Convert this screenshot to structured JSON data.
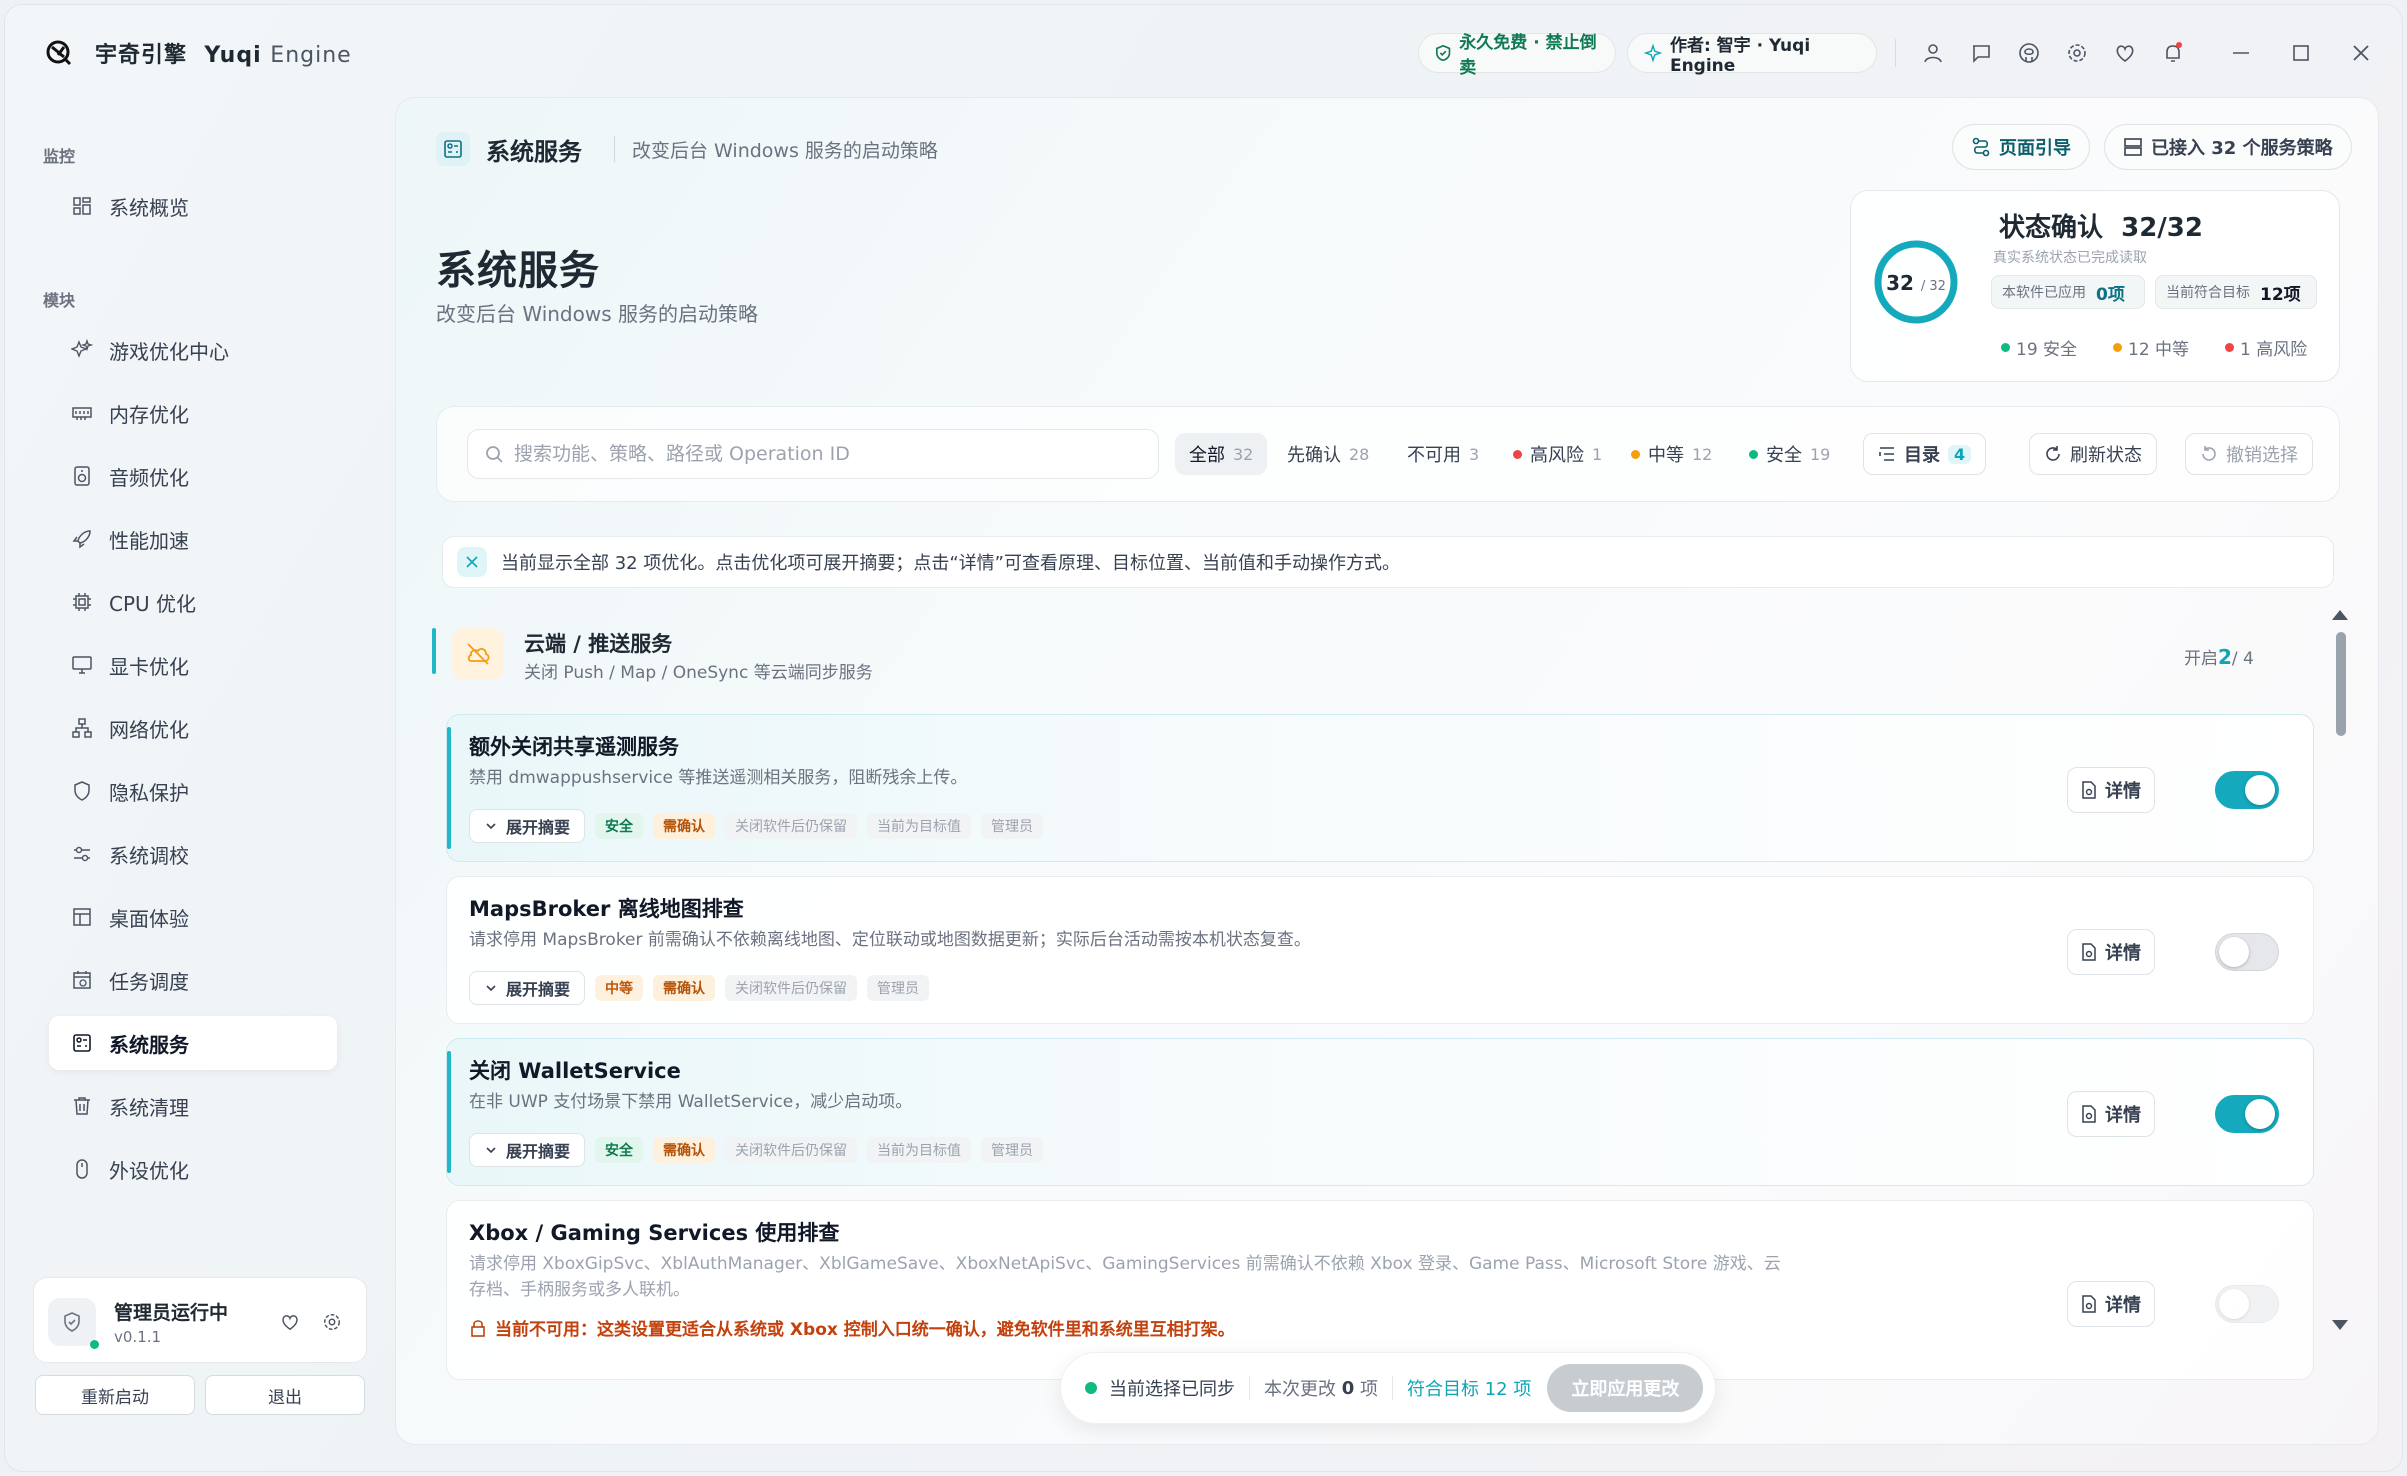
{
  "app": {
    "name_cn": "宇奇引擎",
    "name_en_bold": "Yuqi",
    "name_en_light": "Engine",
    "badge_free": "永久免费 · 禁止倒卖",
    "badge_author": "作者: 智宇 · Yuqi Engine"
  },
  "sidebar": {
    "section_monitor": "监控",
    "section_modules": "模块",
    "items": [
      {
        "label": "系统概览",
        "icon": "grid-icon"
      },
      {
        "label": "游戏优化中心",
        "icon": "sparkle-icon"
      },
      {
        "label": "内存优化",
        "icon": "memory-icon"
      },
      {
        "label": "音频优化",
        "icon": "speaker-icon"
      },
      {
        "label": "性能加速",
        "icon": "rocket-icon"
      },
      {
        "label": "CPU 优化",
        "icon": "cpu-icon"
      },
      {
        "label": "显卡优化",
        "icon": "monitor-icon"
      },
      {
        "label": "网络优化",
        "icon": "network-icon"
      },
      {
        "label": "隐私保护",
        "icon": "shield-icon"
      },
      {
        "label": "系统调校",
        "icon": "sliders-icon"
      },
      {
        "label": "桌面体验",
        "icon": "layout-icon"
      },
      {
        "label": "任务调度",
        "icon": "calendar-icon"
      },
      {
        "label": "系统服务",
        "icon": "services-icon"
      },
      {
        "label": "系统清理",
        "icon": "trash-icon"
      },
      {
        "label": "外设优化",
        "icon": "mouse-icon"
      }
    ],
    "admin_name": "管理员运行中",
    "admin_version": "v0.1.1",
    "restart_label": "重新启动",
    "exit_label": "退出"
  },
  "header": {
    "breadcrumb_title": "系统服务",
    "breadcrumb_desc": "改变后台 Windows 服务的启动策略",
    "guide_label": "页面引导",
    "connected_label": "已接入 32 个服务策略",
    "page_title": "系统服务",
    "page_subtitle": "改变后台 Windows 服务的启动策略"
  },
  "status_card": {
    "title": "状态确认",
    "title_value": "32/32",
    "subtitle": "真实系统状态已完成读取",
    "ring_value": "32",
    "ring_total": "/ 32",
    "ring_fraction": 1.0,
    "chip_applied_label": "本软件已应用",
    "chip_applied_value": "0项",
    "chip_target_label": "当前符合目标",
    "chip_target_value": "12项",
    "legend_safe": "19 安全",
    "legend_mid": "12 中等",
    "legend_high": "1 高风险",
    "colors": {
      "safe": "#10b981",
      "mid": "#f59e0b",
      "high": "#ef4444",
      "accent": "#14a9bd"
    }
  },
  "filters": {
    "search_placeholder": "搜索功能、策略、路径或 Operation ID",
    "tabs": [
      {
        "label": "全部",
        "count": "32"
      },
      {
        "label": "先确认",
        "count": "28"
      },
      {
        "label": "不可用",
        "count": "3"
      },
      {
        "label": "高风险",
        "count": "1"
      },
      {
        "label": "中等",
        "count": "12"
      },
      {
        "label": "安全",
        "count": "19"
      }
    ],
    "toc_label": "目录",
    "toc_count": "4",
    "refresh_label": "刷新状态",
    "undo_label": "撤销选择"
  },
  "hint": {
    "text": "当前显示全部 32 项优化。点击优化项可展开摘要；点击“详情”可查看原理、目标位置、当前值和手动操作方式。"
  },
  "group": {
    "title": "云端 / 推送服务",
    "desc": "关闭 Push / Map / OneSync 等云端同步服务",
    "count_prefix": "开启",
    "count_on": "2",
    "count_total": "/ 4"
  },
  "services": [
    {
      "title": "额外关闭共享遥测服务",
      "desc": "禁用 dmwappushservice 等推送遥测相关服务，阻断残余上传。",
      "expand": "展开摘要",
      "tags": [
        "安全",
        "需确认",
        "关闭软件后仍保留",
        "当前为目标值",
        "管理员"
      ],
      "detail": "详情",
      "enabled": true
    },
    {
      "title": "MapsBroker 离线地图排查",
      "desc": "请求停用 MapsBroker 前需确认不依赖离线地图、定位联动或地图数据更新；实际后台活动需按本机状态复查。",
      "expand": "展开摘要",
      "tags": [
        "中等",
        "需确认",
        "关闭软件后仍保留",
        "管理员"
      ],
      "detail": "详情",
      "enabled": false
    },
    {
      "title": "关闭 WalletService",
      "desc": "在非 UWP 支付场景下禁用 WalletService，减少启动项。",
      "expand": "展开摘要",
      "tags": [
        "安全",
        "需确认",
        "关闭软件后仍保留",
        "当前为目标值",
        "管理员"
      ],
      "detail": "详情",
      "enabled": true
    },
    {
      "title": "Xbox / Gaming Services 使用排查",
      "desc": "请求停用 XboxGipSvc、XblAuthManager、XblGameSave、XboxNetApiSvc、GamingServices 前需确认不依赖 Xbox 登录、Game Pass、Microsoft Store 游戏、云存档、手柄服务或多人联机。",
      "warn": "当前不可用：这类设置更适合从系统或 Xbox 控制入口统一确认，避免软件里和系统里互相打架。",
      "detail": "详情",
      "enabled": false
    }
  ],
  "bottom_bar": {
    "sync_label": "当前选择已同步",
    "changes_label": "本次更改",
    "changes_value": "0",
    "changes_unit": "项",
    "target_label": "符合目标 12 项",
    "apply_label": "立即应用更改"
  }
}
